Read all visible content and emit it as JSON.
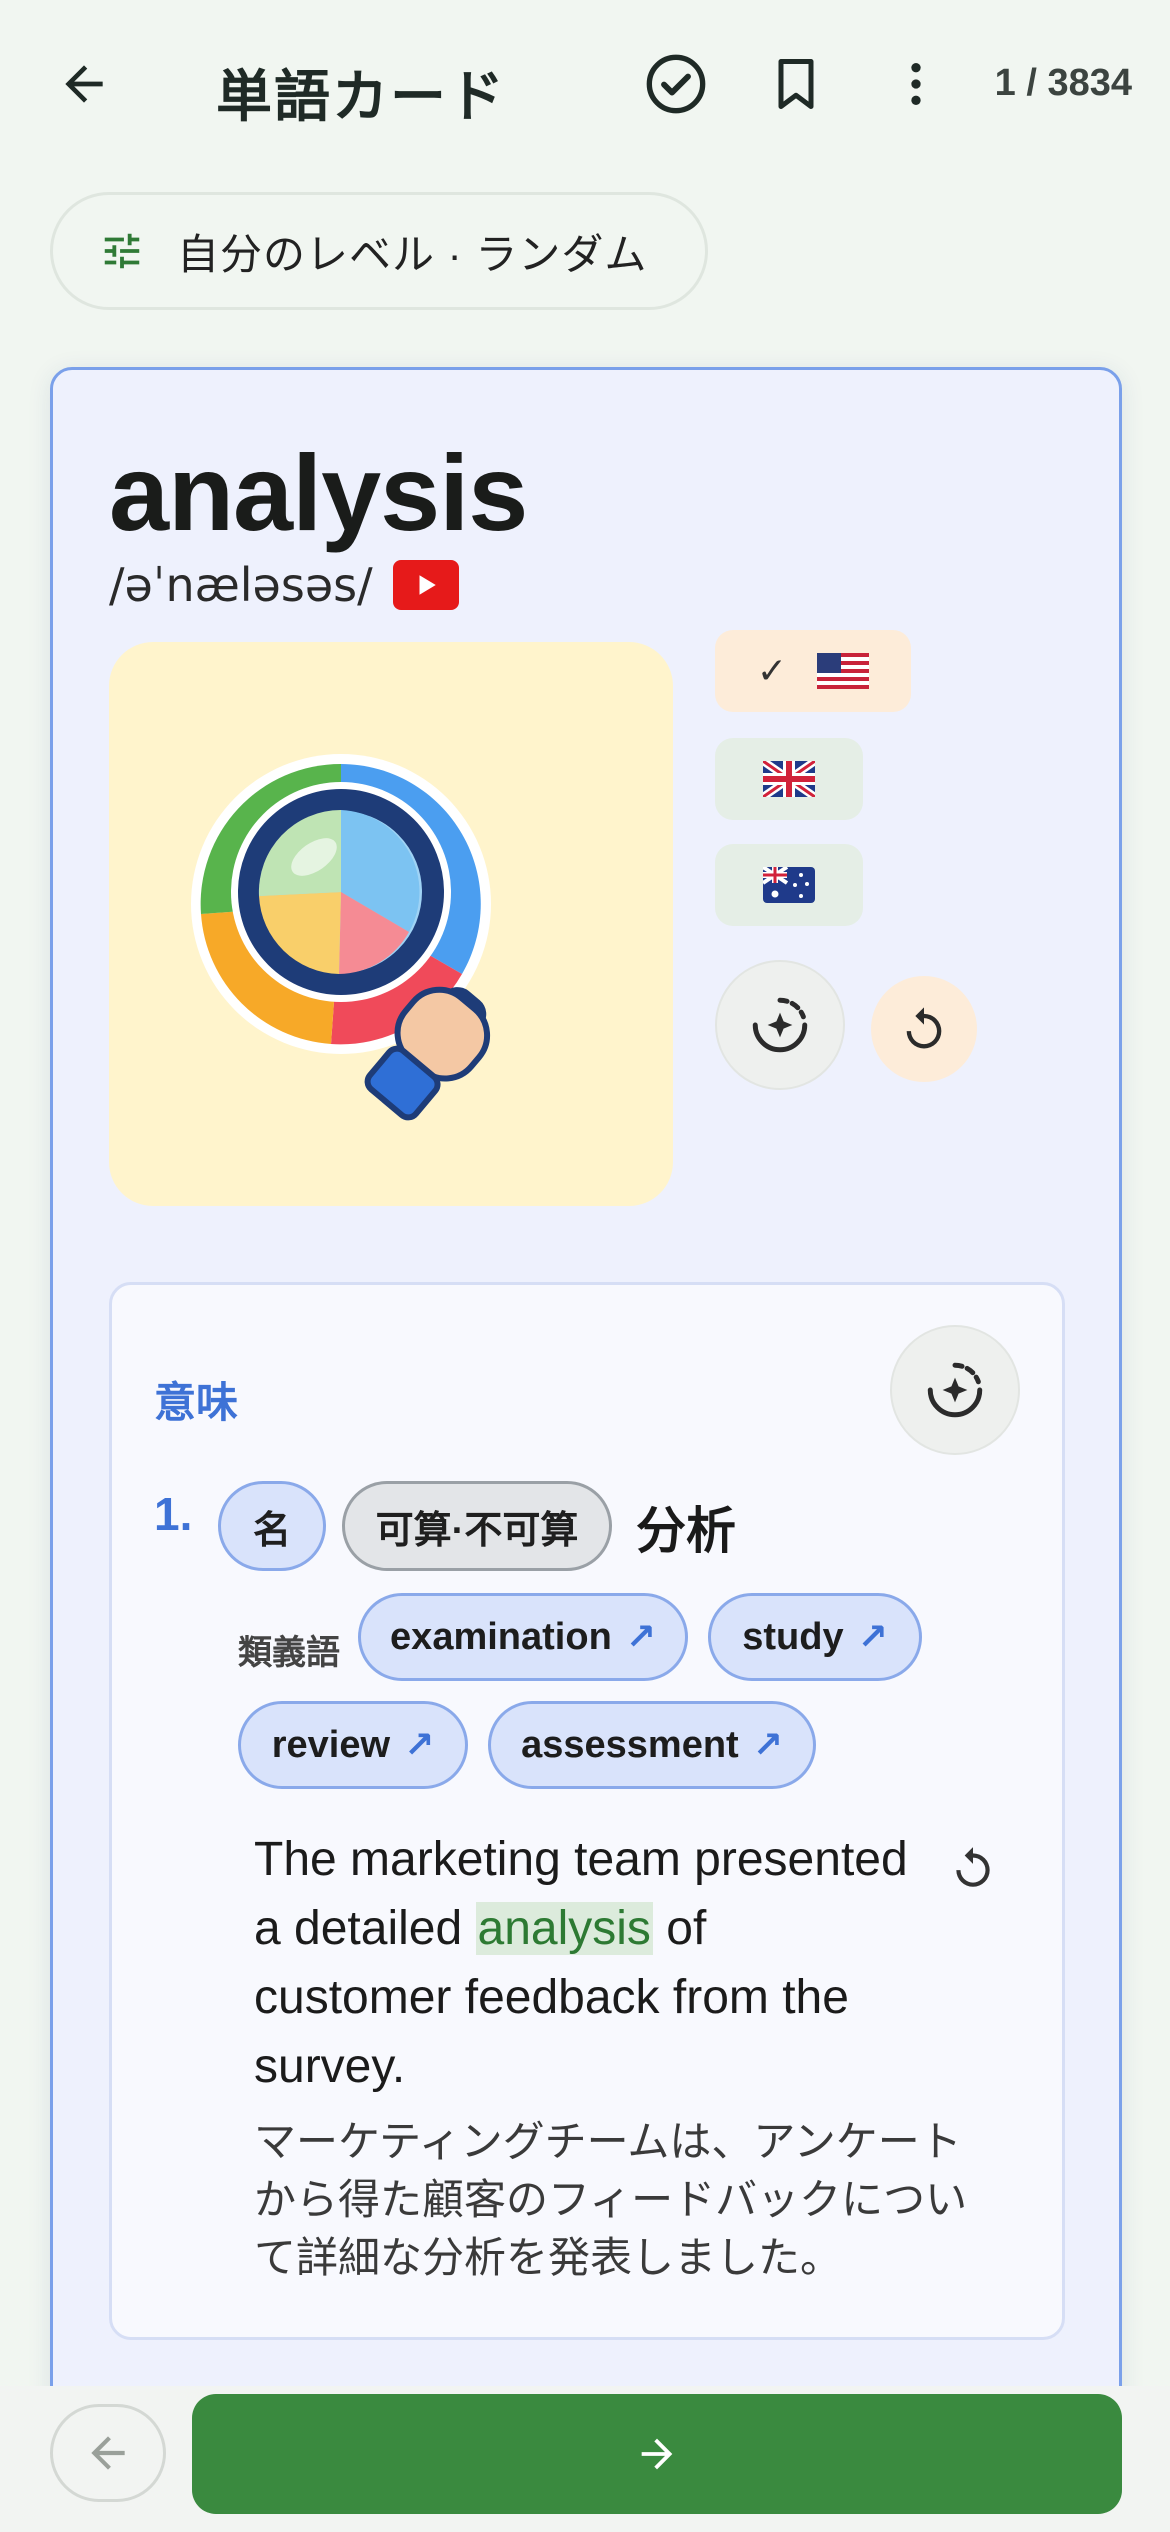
{
  "header": {
    "title": "単語カード",
    "counter": "1 / 3834",
    "icons": [
      "back-arrow-icon",
      "check-circle-icon",
      "bookmark-icon",
      "more-vert-icon"
    ]
  },
  "filter": {
    "label": "自分のレベル · ランダム",
    "icon": "tune-icon"
  },
  "card": {
    "word": "analysis",
    "pronunciation": "/əˈnæləsəs/",
    "accents": [
      {
        "flag": "🇺🇸",
        "selected": true
      },
      {
        "flag": "🇬🇧",
        "selected": false
      },
      {
        "flag": "🇦🇺",
        "selected": false
      }
    ],
    "accent_check": "✓",
    "illustration": "magnifying-glass-over-pie-chart"
  },
  "meaning": {
    "title": "意味",
    "number": "1.",
    "pos": "名",
    "countability": "可算·不可算",
    "definition": "分析",
    "synonyms_label": "類義語",
    "synonyms": [
      "examination",
      "study",
      "review",
      "assessment"
    ],
    "synonym_arrow": "↗",
    "example_before": "The marketing team presented a detailed ",
    "example_highlight": "analysis",
    "example_after": " of customer feedback from the survey.",
    "example_translation": "マーケティングチームは、アンケートから得た顧客のフィードバックについて詳細な分析を発表しました。"
  },
  "colors": {
    "accent_blue": "#3e72d6",
    "primary_green": "#3a8a3f",
    "card_border": "#7aa0ea"
  }
}
